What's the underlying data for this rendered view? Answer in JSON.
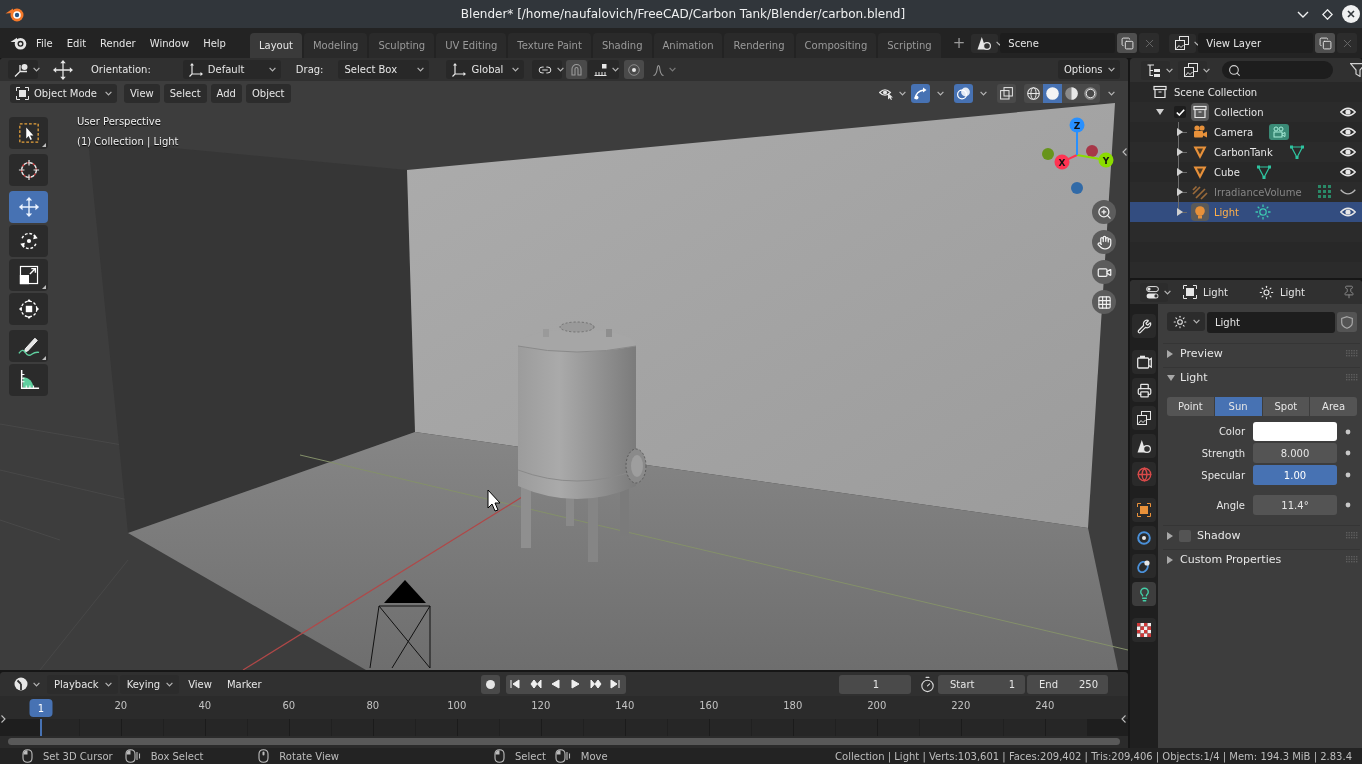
{
  "window": {
    "title": "Blender* [/home/naufalovich/FreeCAD/Carbon Tank/Blender/carbon.blend]"
  },
  "top_bar": {
    "menus": [
      "File",
      "Edit",
      "Render",
      "Window",
      "Help"
    ],
    "workspace_tabs": [
      {
        "label": "Layout",
        "selected": true
      },
      {
        "label": "Modeling",
        "selected": false
      },
      {
        "label": "Sculpting",
        "selected": false
      },
      {
        "label": "UV Editing",
        "selected": false
      },
      {
        "label": "Texture Paint",
        "selected": false
      },
      {
        "label": "Shading",
        "selected": false
      },
      {
        "label": "Animation",
        "selected": false
      },
      {
        "label": "Rendering",
        "selected": false
      },
      {
        "label": "Compositing",
        "selected": false
      },
      {
        "label": "Scripting",
        "selected": false
      }
    ],
    "add_workspace": "+",
    "scene": "Scene",
    "view_layer": "View Layer"
  },
  "viewport": {
    "tool_settings": {
      "orientation_label": "Orientation:",
      "orientation": "Default",
      "drag_label": "Drag:",
      "drag": "Select Box",
      "transform_orientation": "Global",
      "snap": false,
      "proportional_editing": false,
      "options": "Options"
    },
    "header": {
      "mode": "Object Mode",
      "menus": [
        "View",
        "Select",
        "Add",
        "Object"
      ],
      "show_gizmos": true,
      "show_overlays": true,
      "xray": false,
      "shading": [
        {
          "kind": "wireframe",
          "selected": false
        },
        {
          "kind": "solid",
          "selected": true
        },
        {
          "kind": "material",
          "selected": false
        },
        {
          "kind": "rendered",
          "selected": false
        }
      ]
    },
    "tool_groups": [
      [
        {
          "kind": "select_box",
          "selected": false,
          "more": true
        }
      ],
      [
        {
          "kind": "cursor",
          "selected": false,
          "more": false
        }
      ],
      [
        {
          "kind": "move",
          "selected": true,
          "more": false
        },
        {
          "kind": "rotate",
          "selected": false,
          "more": false
        },
        {
          "kind": "scale",
          "selected": false,
          "more": true
        },
        {
          "kind": "transform",
          "selected": false,
          "more": false
        }
      ],
      [
        {
          "kind": "annotate",
          "selected": false,
          "more": true
        },
        {
          "kind": "measure",
          "selected": false,
          "more": false
        }
      ]
    ],
    "info": [
      "User Perspective",
      "(1) Collection | Light"
    ],
    "axes": [
      {
        "label": "X",
        "color": "#ff3352"
      },
      {
        "label": "Y",
        "color": "#8bdc00"
      },
      {
        "label": "Z",
        "color": "#2890ff"
      }
    ]
  },
  "outliner": {
    "tree": [
      {
        "label": "Scene Collection",
        "kind": "scene_collection",
        "selected": false,
        "active": false,
        "children": [
          {
            "label": "Collection",
            "kind": "collection",
            "selected": false,
            "active": true,
            "checked": true,
            "expanded": true,
            "visible": true,
            "children": [
              {
                "label": "Camera",
                "kind": "camera",
                "selected": false,
                "active": false,
                "expanded": false,
                "visible": true
              },
              {
                "label": "CarbonTank",
                "kind": "mesh",
                "selected": false,
                "active": false,
                "expanded": false,
                "visible": true
              },
              {
                "label": "Cube",
                "kind": "mesh",
                "selected": false,
                "active": false,
                "expanded": false,
                "visible": true
              },
              {
                "label": "IrradianceVolume",
                "kind": "light_probe",
                "selected": false,
                "active": false,
                "expanded": false,
                "visible": false
              },
              {
                "label": "Light",
                "kind": "light",
                "selected": true,
                "active": true,
                "expanded": false,
                "visible": true
              }
            ]
          }
        ]
      }
    ]
  },
  "properties": {
    "object": "Light",
    "data": "Light",
    "tab_groups": [
      [
        {
          "kind": "tool",
          "selected": false
        }
      ],
      [
        {
          "kind": "render",
          "selected": false
        },
        {
          "kind": "output",
          "selected": false
        },
        {
          "kind": "view_layer",
          "selected": false
        },
        {
          "kind": "scene",
          "selected": false
        },
        {
          "kind": "world",
          "selected": false
        }
      ],
      [
        {
          "kind": "object",
          "selected": false
        },
        {
          "kind": "physics",
          "selected": false
        },
        {
          "kind": "constraints",
          "selected": false
        },
        {
          "kind": "data",
          "selected": true
        }
      ],
      [
        {
          "kind": "texture",
          "selected": false
        }
      ]
    ],
    "datablock": "Light",
    "panels": [
      {
        "title": "Preview",
        "expanded": false
      },
      {
        "title": "Light",
        "expanded": true,
        "types": [
          {
            "label": "Point",
            "selected": false
          },
          {
            "label": "Sun",
            "selected": true
          },
          {
            "label": "Spot",
            "selected": false
          },
          {
            "label": "Area",
            "selected": false
          }
        ],
        "field_groups": [
          [
            {
              "kind": "color",
              "label": "Color",
              "color": "#ffffff"
            },
            {
              "kind": "number",
              "label": "Strength",
              "value": "8.000"
            },
            {
              "kind": "slider",
              "label": "Specular",
              "value": "1.00",
              "level": 1
            }
          ],
          [
            {
              "kind": "number",
              "label": "Angle",
              "value": "11.4°"
            }
          ]
        ]
      },
      {
        "title": "Shadow",
        "expanded": false,
        "checked": false
      },
      {
        "title": "Custom Properties",
        "expanded": false
      }
    ]
  },
  "timeline": {
    "menus": [
      {
        "label": "Playback",
        "dropdown": true
      },
      {
        "label": "Keying",
        "dropdown": true
      },
      {
        "label": "View",
        "dropdown": false
      },
      {
        "label": "Marker",
        "dropdown": false
      }
    ],
    "auto_keying": false,
    "current_frame": "1",
    "start_label": "Start",
    "start": "1",
    "end_label": "End",
    "end": "250",
    "ruler": [
      "20",
      "40",
      "60",
      "80",
      "100",
      "120",
      "140",
      "160",
      "180",
      "200",
      "220",
      "240"
    ],
    "playhead": "1"
  },
  "status_bar": {
    "hints": [
      {
        "kind": "click",
        "label": "Set 3D Cursor"
      },
      {
        "kind": "drag",
        "label": "Box Select"
      },
      {
        "kind": "middle",
        "label": "Rotate View"
      },
      {
        "kind": "click",
        "label": "Select"
      },
      {
        "kind": "drag",
        "label": "Move"
      }
    ],
    "stats": "Collection | Light | Verts:103,601 | Faces:209,402 | Tris:209,406 | Objects:1/4 | Mem: 194.3 MiB | 2.83.4"
  }
}
